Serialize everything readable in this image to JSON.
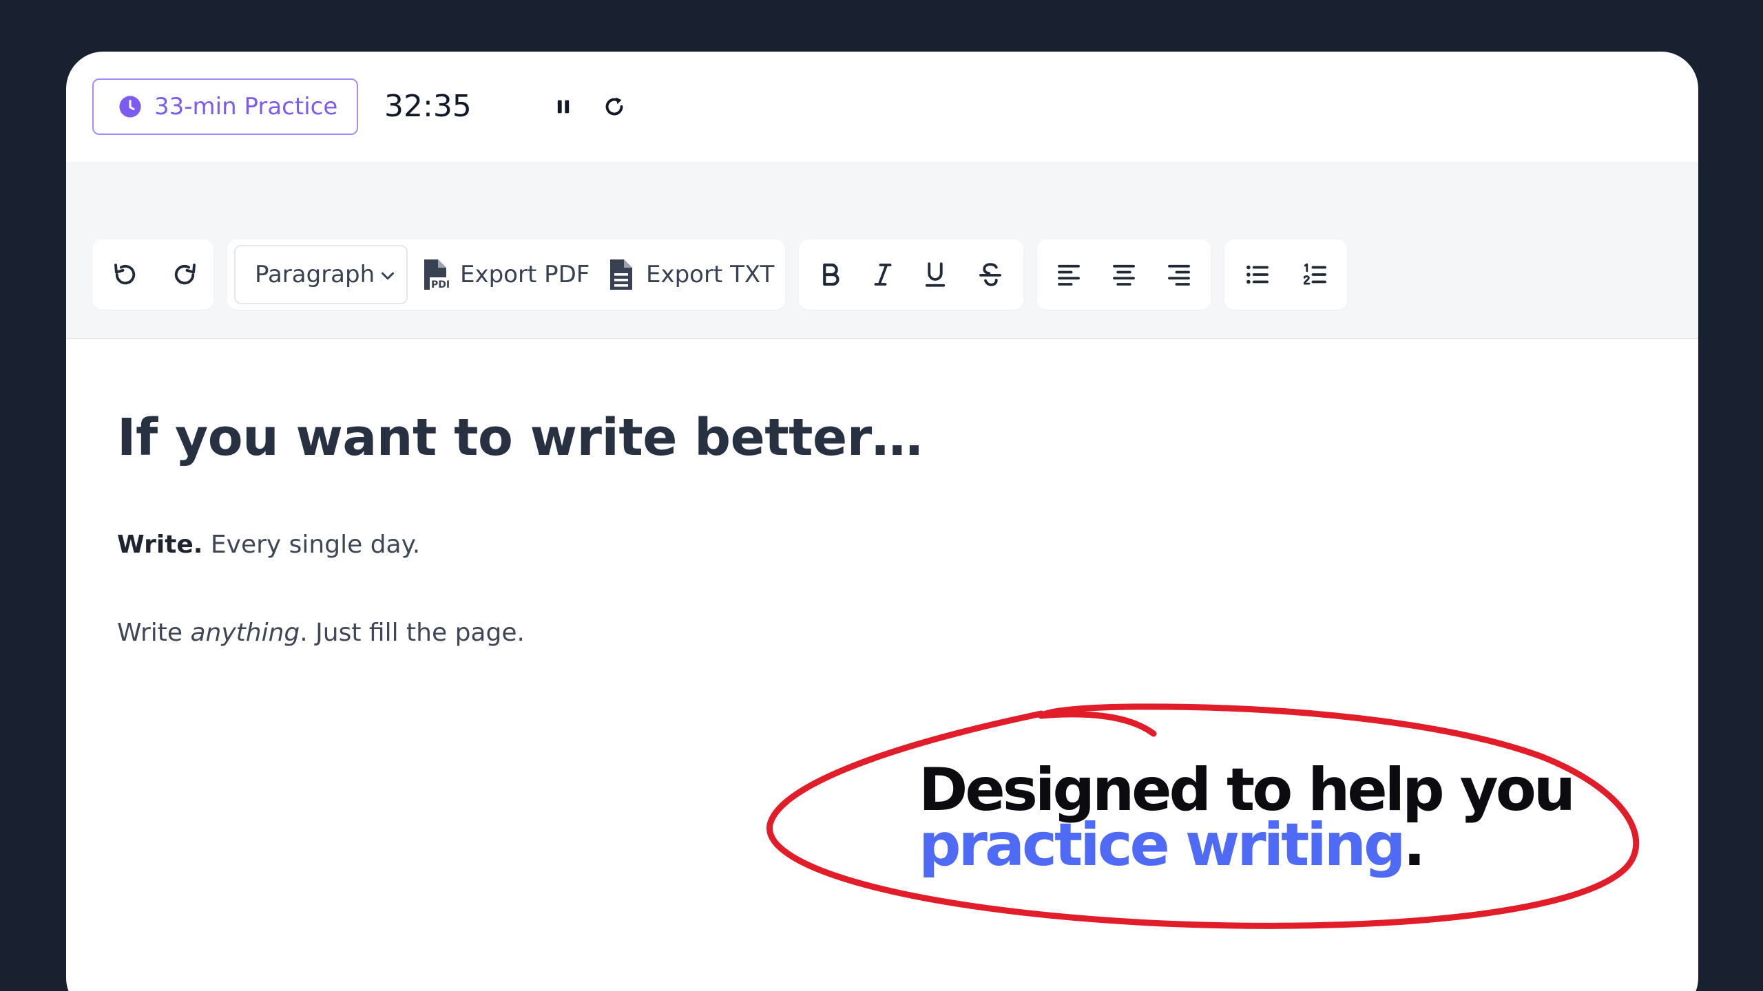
{
  "timerbar": {
    "practice_label": "33-min Practice",
    "time": "32:35"
  },
  "toolbar": {
    "block_type": "Paragraph",
    "export_pdf": "Export PDF",
    "export_txt": "Export TXT",
    "pdf_icon_text": "PDF"
  },
  "document": {
    "heading": "If you want to write better…",
    "p1_bold": "Write.",
    "p1_rest": " Every single day.",
    "p2_start": "Write ",
    "p2_italic": "anything",
    "p2_rest": ". Just fill the page."
  },
  "callout": {
    "line1": "Designed to help you",
    "line2_highlight": "practice writing",
    "line2_end": "."
  },
  "colors": {
    "background": "#19202f",
    "accent_purple": "#7c5cf0",
    "highlight_blue": "#4f6bf5",
    "annotation_red": "#e11d2a"
  }
}
